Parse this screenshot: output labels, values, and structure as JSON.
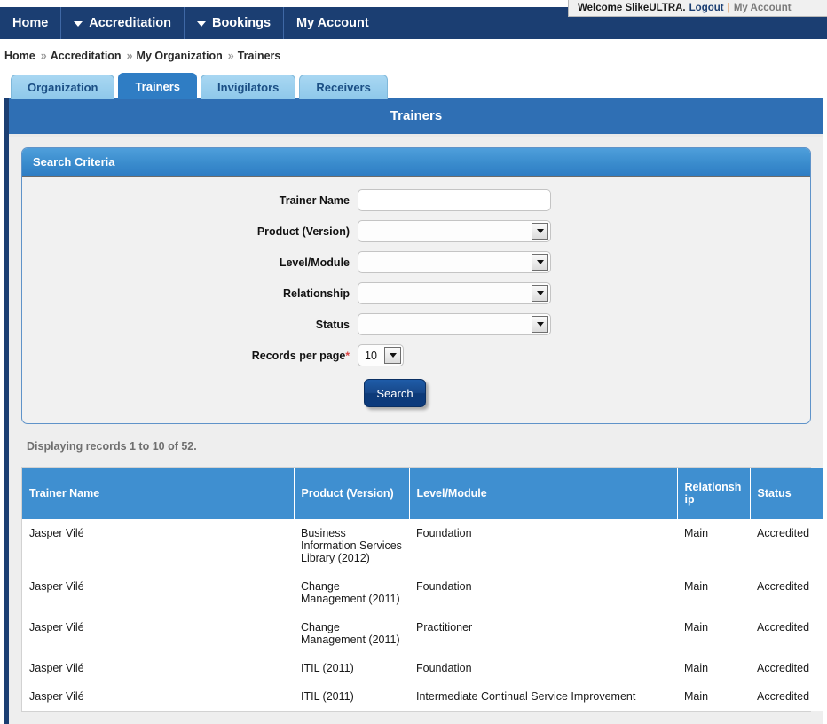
{
  "welcome": {
    "greeting": "Welcome SlikeULTRA.",
    "logout_label": "Logout",
    "separator": "|",
    "account_label": "My Account"
  },
  "navbar": {
    "items": [
      {
        "label": "Home",
        "caret": false
      },
      {
        "label": "Accreditation",
        "caret": true
      },
      {
        "label": "Bookings",
        "caret": true
      },
      {
        "label": "My Account",
        "caret": false
      }
    ]
  },
  "breadcrumb": {
    "separator": "»",
    "items": [
      "Home",
      "Accreditation",
      "My Organization",
      "Trainers"
    ]
  },
  "tabs": [
    {
      "label": "Organization",
      "active": false
    },
    {
      "label": "Trainers",
      "active": true
    },
    {
      "label": "Invigilators",
      "active": false
    },
    {
      "label": "Receivers",
      "active": false
    }
  ],
  "page": {
    "title": "Trainers"
  },
  "search": {
    "panel_title": "Search Criteria",
    "fields": {
      "trainer_name_label": "Trainer Name",
      "trainer_name_value": "",
      "product_label": "Product (Version)",
      "product_value": "",
      "level_label": "Level/Module",
      "level_value": "",
      "relationship_label": "Relationship",
      "relationship_value": "",
      "status_label": "Status",
      "status_value": "",
      "records_per_page_label": "Records per page",
      "records_per_page_value": "10",
      "required_marker": "*"
    },
    "search_button_label": "Search"
  },
  "results": {
    "displaying_text": "Displaying records 1 to 10 of 52.",
    "columns": [
      "Trainer Name",
      "Product (Version)",
      "Level/Module",
      "Relationship",
      "Status"
    ],
    "rows": [
      {
        "trainer_name": "Jasper Vilé",
        "product": "Business Information Services Library (2012)",
        "level": "Foundation",
        "relationship": "Main",
        "status": "Accredited"
      },
      {
        "trainer_name": "Jasper Vilé",
        "product": "Change Management (2011)",
        "level": "Foundation",
        "relationship": "Main",
        "status": "Accredited"
      },
      {
        "trainer_name": "Jasper Vilé",
        "product": "Change Management (2011)",
        "level": "Practitioner",
        "relationship": "Main",
        "status": "Accredited"
      },
      {
        "trainer_name": "Jasper Vilé",
        "product": "ITIL (2011)",
        "level": "Foundation",
        "relationship": "Main",
        "status": "Accredited"
      },
      {
        "trainer_name": "Jasper Vilé",
        "product": "ITIL (2011)",
        "level": "Intermediate Continual Service Improvement",
        "relationship": "Main",
        "status": "Accredited"
      }
    ]
  },
  "colors": {
    "navy": "#1b3e72",
    "header_blue": "#2f6fb4",
    "table_header_blue": "#3f8fd0",
    "tab_light": "#8ec8ea",
    "page_bg": "#eeeeee",
    "required_red": "#d94141"
  }
}
